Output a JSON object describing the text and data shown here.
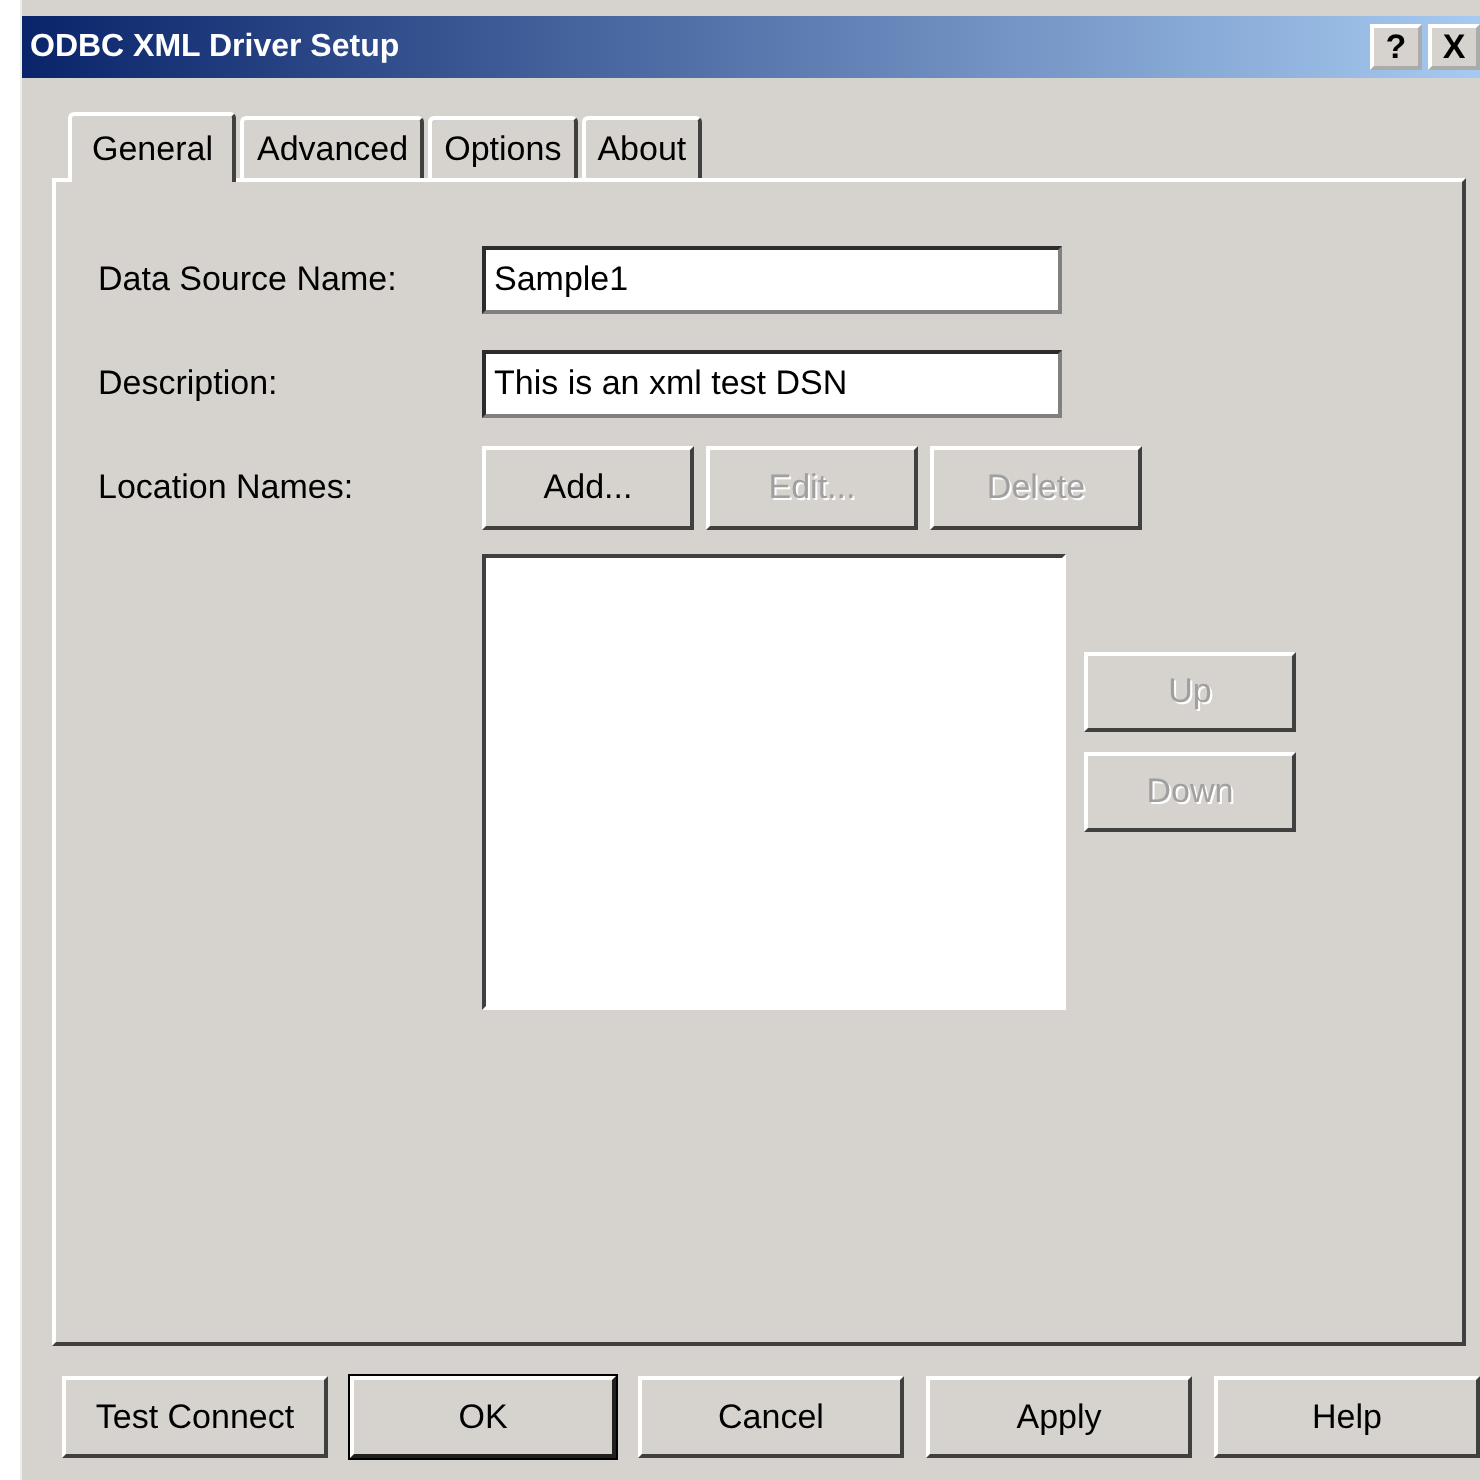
{
  "window": {
    "title": "ODBC XML Driver Setup",
    "help_button": "?",
    "close_button": "X"
  },
  "tabs": [
    {
      "label": "General",
      "selected": true
    },
    {
      "label": "Advanced",
      "selected": false
    },
    {
      "label": "Options",
      "selected": false
    },
    {
      "label": "About",
      "selected": false
    }
  ],
  "fields": [
    {
      "label": "Data Source Name:",
      "value": "Sample1"
    },
    {
      "label": "Description:",
      "value": "This is an xml test DSN"
    }
  ],
  "location": {
    "label": "Location Names:",
    "buttons": [
      {
        "label": "Add...",
        "disabled": false
      },
      {
        "label": "Edit...",
        "disabled": true
      },
      {
        "label": "Delete",
        "disabled": true
      }
    ],
    "move_buttons": [
      {
        "label": "Up",
        "disabled": true
      },
      {
        "label": "Down",
        "disabled": true
      }
    ]
  },
  "footer_buttons": [
    {
      "label": "Test Connect",
      "default": false
    },
    {
      "label": "OK",
      "default": true
    },
    {
      "label": "Cancel",
      "default": false
    },
    {
      "label": "Apply",
      "default": false
    },
    {
      "label": "Help",
      "default": false
    }
  ]
}
